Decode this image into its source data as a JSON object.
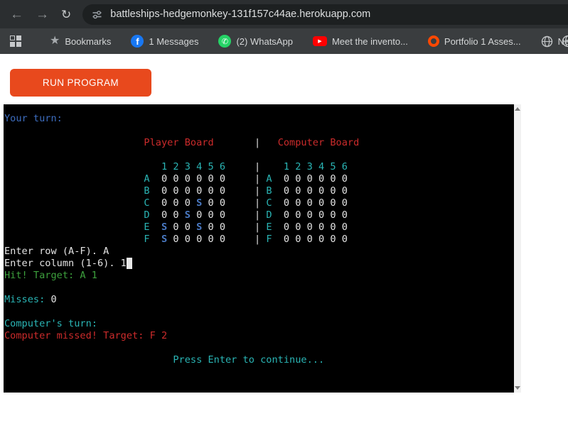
{
  "browser": {
    "url": "battleships-hedgemonkey-131f157c44ae.herokuapp.com",
    "icons": {
      "back": "←",
      "forward": "→",
      "reload": "↻",
      "star": "★",
      "facebook_letter": "f",
      "whatsapp_phone": "✆",
      "youtube_play": "▶"
    },
    "bookmarks": [
      {
        "label": "Bookmarks",
        "icon": "star-icon"
      },
      {
        "label": "1 Messages",
        "icon": "facebook-icon"
      },
      {
        "label": "(2) WhatsApp",
        "icon": "whatsapp-icon"
      },
      {
        "label": "Meet the invento...",
        "icon": "youtube-icon"
      },
      {
        "label": "Portfolio 1 Asses...",
        "icon": "orange-ring-icon"
      },
      {
        "label": "New Tab",
        "icon": "globe-icon"
      }
    ]
  },
  "page": {
    "run_button_label": "RUN PROGRAM"
  },
  "colors": {
    "accent_orange": "#e8491d",
    "topbar_bg": "#2b2e30",
    "bookmarks_bg": "#3a3d3f",
    "terminal_bg": "#000000",
    "facebook_blue": "#1877f2",
    "whatsapp_green": "#25d366",
    "youtube_red": "#ff0000",
    "portfolio_orange": "#ff4802"
  },
  "terminal": {
    "palette": {
      "w": "#e4e4e4",
      "c": "#2ab5b5",
      "r": "#cc2b2b",
      "g": "#3da03d",
      "b": "#3d6dbf",
      "s": "#4a7ac4"
    },
    "lines": [
      [
        {
          "t": "Your turn:",
          "c": "b"
        }
      ],
      [],
      [
        {
          "pad": 24
        },
        {
          "t": "Player Board",
          "c": "r"
        },
        {
          "pad": 7
        },
        {
          "t": "|",
          "c": "w"
        },
        {
          "pad": 3
        },
        {
          "t": "Computer Board",
          "c": "r"
        }
      ],
      [],
      [
        {
          "pad": 27
        },
        {
          "t": "1 2 3 4 5 6",
          "c": "c"
        },
        {
          "pad": 5
        },
        {
          "t": "|",
          "c": "w"
        },
        {
          "pad": 4
        },
        {
          "t": "1 2 3 4 5 6",
          "c": "c"
        }
      ],
      [
        {
          "pad": 24
        },
        {
          "t": "A",
          "c": "c"
        },
        {
          "pad": 2
        },
        {
          "t": "0 0 0 0 0 0",
          "c": "w"
        },
        {
          "pad": 5
        },
        {
          "t": "|",
          "c": "w"
        },
        {
          "pad": 1
        },
        {
          "t": "A",
          "c": "c"
        },
        {
          "pad": 2
        },
        {
          "t": "0 0 0 0 0 0",
          "c": "w"
        }
      ],
      [
        {
          "pad": 24
        },
        {
          "t": "B",
          "c": "c"
        },
        {
          "pad": 2
        },
        {
          "t": "0 0 0 0 0 0",
          "c": "w"
        },
        {
          "pad": 5
        },
        {
          "t": "|",
          "c": "w"
        },
        {
          "pad": 1
        },
        {
          "t": "B",
          "c": "c"
        },
        {
          "pad": 2
        },
        {
          "t": "0 0 0 0 0 0",
          "c": "w"
        }
      ],
      [
        {
          "pad": 24
        },
        {
          "t": "C",
          "c": "c"
        },
        {
          "pad": 2
        },
        {
          "t": "0 0 0 ",
          "c": "w"
        },
        {
          "t": "S",
          "c": "s"
        },
        {
          "t": " 0 0",
          "c": "w"
        },
        {
          "pad": 5
        },
        {
          "t": "|",
          "c": "w"
        },
        {
          "pad": 1
        },
        {
          "t": "C",
          "c": "c"
        },
        {
          "pad": 2
        },
        {
          "t": "0 0 0 0 0 0",
          "c": "w"
        }
      ],
      [
        {
          "pad": 24
        },
        {
          "t": "D",
          "c": "c"
        },
        {
          "pad": 2
        },
        {
          "t": "0 0 ",
          "c": "w"
        },
        {
          "t": "S",
          "c": "s"
        },
        {
          "t": " 0 0 0",
          "c": "w"
        },
        {
          "pad": 5
        },
        {
          "t": "|",
          "c": "w"
        },
        {
          "pad": 1
        },
        {
          "t": "D",
          "c": "c"
        },
        {
          "pad": 2
        },
        {
          "t": "0 0 0 0 0 0",
          "c": "w"
        }
      ],
      [
        {
          "pad": 24
        },
        {
          "t": "E",
          "c": "c"
        },
        {
          "pad": 2
        },
        {
          "t": "S",
          "c": "s"
        },
        {
          "t": " 0 0 ",
          "c": "w"
        },
        {
          "t": "S",
          "c": "s"
        },
        {
          "t": " 0 0",
          "c": "w"
        },
        {
          "pad": 5
        },
        {
          "t": "|",
          "c": "w"
        },
        {
          "pad": 1
        },
        {
          "t": "E",
          "c": "c"
        },
        {
          "pad": 2
        },
        {
          "t": "0 0 0 0 0 0",
          "c": "w"
        }
      ],
      [
        {
          "pad": 24
        },
        {
          "t": "F",
          "c": "c"
        },
        {
          "pad": 2
        },
        {
          "t": "S",
          "c": "s"
        },
        {
          "t": " 0 0 0 0 0",
          "c": "w"
        },
        {
          "pad": 5
        },
        {
          "t": "|",
          "c": "w"
        },
        {
          "pad": 1
        },
        {
          "t": "F",
          "c": "c"
        },
        {
          "pad": 2
        },
        {
          "t": "0 0 0 0 0 0",
          "c": "w"
        }
      ],
      [
        {
          "t": "Enter row (A-F). A",
          "c": "w"
        }
      ],
      [
        {
          "t": "Enter column (1-6). 1",
          "c": "w"
        },
        {
          "t": " ",
          "c": "cur"
        }
      ],
      [
        {
          "t": "Hit! Target: A 1",
          "c": "g"
        }
      ],
      [],
      [
        {
          "t": "Misses:",
          "c": "c"
        },
        {
          "t": " 0",
          "c": "w"
        }
      ],
      [],
      [
        {
          "t": "Computer's turn:",
          "c": "c"
        }
      ],
      [
        {
          "t": "Computer missed! Target: F 2",
          "c": "r"
        }
      ],
      [],
      [
        {
          "pad": 29
        },
        {
          "t": "Press Enter to continue...",
          "c": "c"
        }
      ]
    ]
  }
}
